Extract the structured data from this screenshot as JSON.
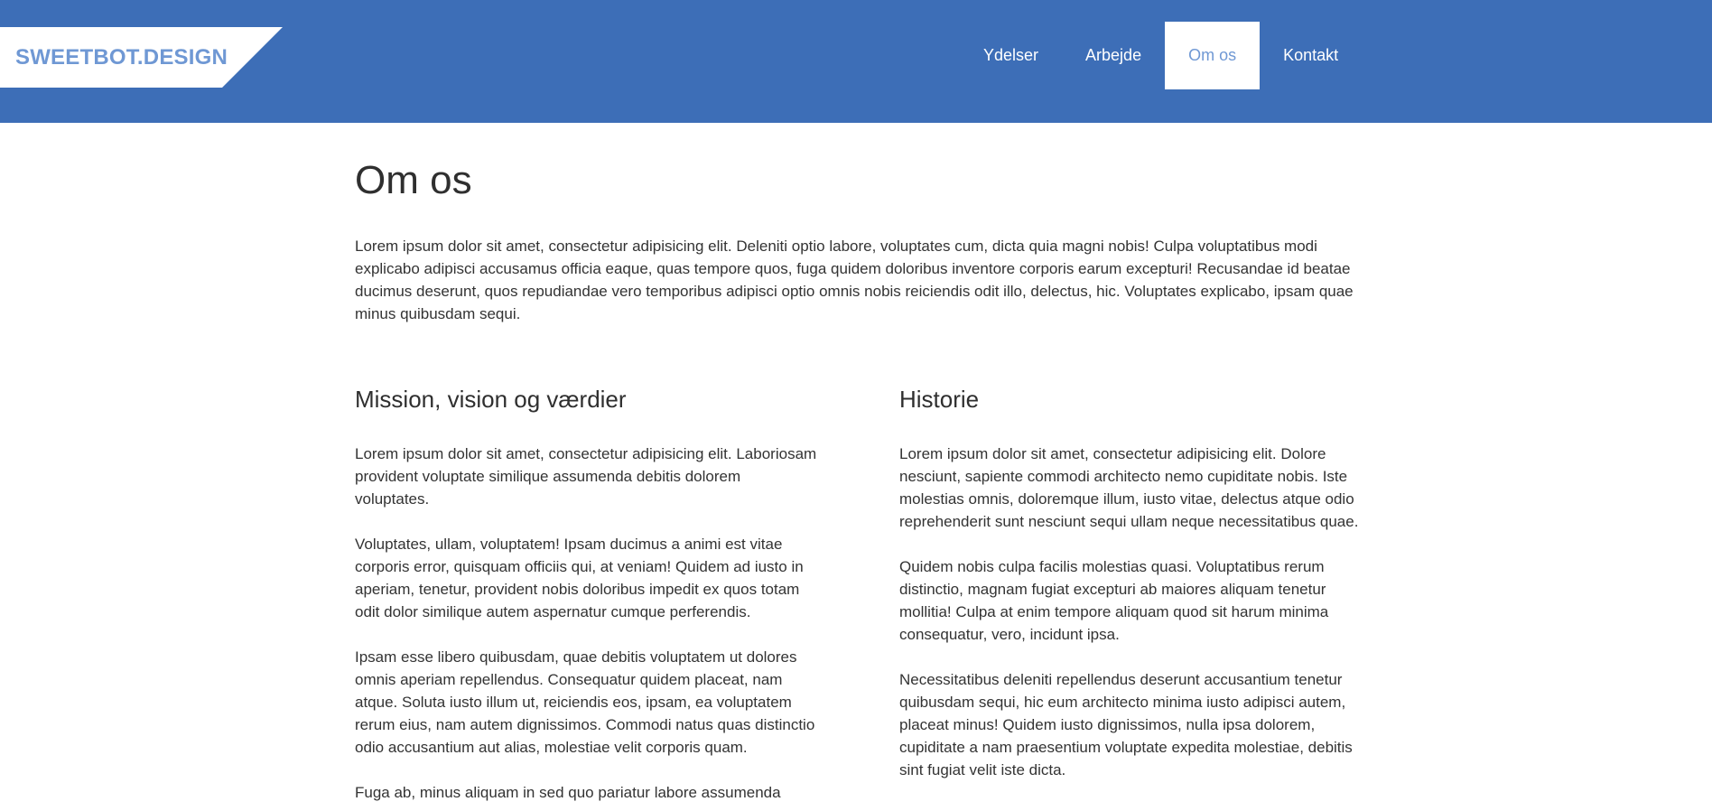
{
  "header": {
    "logo": "SWEETBOT.DESIGN",
    "nav": [
      {
        "label": "Ydelser"
      },
      {
        "label": "Arbejde"
      },
      {
        "label": "Om os"
      },
      {
        "label": "Kontakt"
      }
    ],
    "active_nav": "Om os",
    "bg_color": "#3d6eb7",
    "logo_color": "#6f98d4"
  },
  "main": {
    "title": "Om os",
    "intro": "Lorem ipsum dolor sit amet, consectetur adipisicing elit. Deleniti optio labore, voluptates cum, dicta quia magni nobis! Culpa voluptatibus modi explicabo adipisci accusamus officia eaque, quas tempore quos, fuga quidem doloribus inventore corporis earum excepturi! Recusandae id beatae ducimus deserunt, quos repudiandae vero temporibus adipisci optio omnis nobis reiciendis odit illo, delectus, hic. Voluptates explicabo, ipsam quae minus quibusdam sequi.",
    "mission": {
      "heading": "Mission, vision og værdier",
      "paragraphs": [
        "Lorem ipsum dolor sit amet, consectetur adipisicing elit. Laboriosam provident voluptate similique assumenda debitis dolorem voluptates.",
        "Voluptates, ullam, voluptatem! Ipsam ducimus a animi est vitae corporis error, quisquam officiis qui, at veniam! Quidem ad iusto in aperiam, tenetur, provident nobis doloribus impedit ex quos totam odit dolor similique autem aspernatur cumque perferendis.",
        "Ipsam esse libero quibusdam, quae debitis voluptatem ut dolores omnis aperiam repellendus. Consequatur quidem placeat, nam atque. Soluta iusto illum ut, reiciendis eos, ipsam, ea voluptatem rerum eius, nam autem dignissimos. Commodi natus quas distinctio odio accusantium aut alias, molestiae velit corporis quam.",
        "Fuga ab, minus aliquam in sed quo pariatur labore assumenda"
      ]
    },
    "history": {
      "heading": "Historie",
      "paragraphs": [
        "Lorem ipsum dolor sit amet, consectetur adipisicing elit. Dolore nesciunt, sapiente commodi architecto nemo cupiditate nobis. Iste molestias omnis, doloremque illum, iusto vitae, delectus atque odio reprehenderit sunt nesciunt sequi ullam neque necessitatibus quae.",
        "Quidem nobis culpa facilis molestias quasi. Voluptatibus rerum distinctio, magnam fugiat excepturi ab maiores aliquam tenetur mollitia! Culpa at enim tempore aliquam quod sit harum minima consequatur, vero, incidunt ipsa.",
        "Necessitatibus deleniti repellendus deserunt accusantium tenetur quibusdam sequi, hic eum architecto minima iusto adipisci autem, placeat minus! Quidem iusto dignissimos, nulla ipsa dolorem, cupiditate a nam praesentium voluptate expedita molestiae, debitis sint fugiat velit iste dicta."
      ]
    }
  }
}
